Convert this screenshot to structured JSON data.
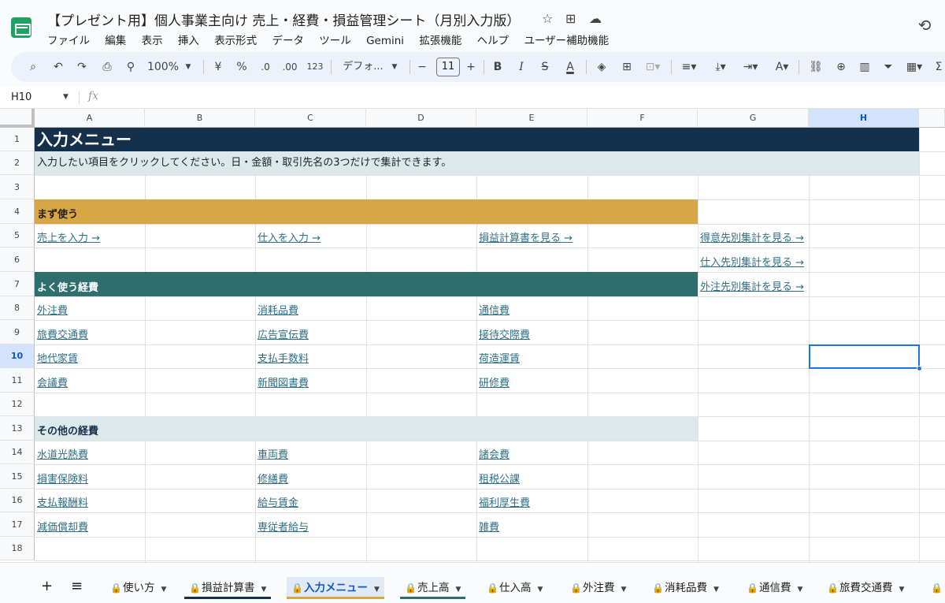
{
  "window": {
    "title": "【プレゼント用】個人事業主向け 売上・経費・損益管理シート（月別入力版）",
    "menu": [
      "ファイル",
      "編集",
      "表示",
      "挿入",
      "表示形式",
      "データ",
      "ツール",
      "Gemini",
      "拡張機能",
      "ヘルプ",
      "ユーザー補助機能"
    ]
  },
  "toolbar": {
    "zoom": "100%",
    "currency": "¥",
    "percent": "%",
    "dec_minus": ".0",
    "dec_plus": ".00",
    "number_format": "123",
    "font": "デフォ...",
    "font_size": "11"
  },
  "formula_bar": {
    "cell_ref": "H10",
    "fx": "fx"
  },
  "columns": [
    "A",
    "B",
    "C",
    "D",
    "E",
    "F",
    "G",
    "H"
  ],
  "rows": [
    "1",
    "2",
    "3",
    "4",
    "5",
    "6",
    "7",
    "8",
    "9",
    "10",
    "11",
    "12",
    "13",
    "14",
    "15",
    "16",
    "17",
    "18"
  ],
  "selected_cell": "H10",
  "sheet": {
    "title": "入力メニュー",
    "instruction": "入力したい項目をクリックしてください。日・金額・取引先名の3つだけで集計できます。",
    "section_first": "まず使う",
    "first_links": [
      "売上を入力 →",
      "仕入を入力 →",
      "損益計算書を見る →"
    ],
    "side_links": [
      "得意先別集計を見る →",
      "仕入先別集計を見る →",
      "外注先別集計を見る →"
    ],
    "section_common": "よく使う経費",
    "common": [
      [
        "外注費",
        "消耗品費",
        "通信費"
      ],
      [
        "旅費交通費",
        "広告宣伝費",
        "接待交際費"
      ],
      [
        "地代家賃",
        "支払手数料",
        "荷造運賃"
      ],
      [
        "会議費",
        "新聞図書費",
        "研修費"
      ]
    ],
    "section_other": "その他の経費",
    "other": [
      [
        "水道光熱費",
        "車両費",
        "諸会費"
      ],
      [
        "損害保険料",
        "修繕費",
        "租税公課"
      ],
      [
        "支払報酬料",
        "給与賃金",
        "福利厚生費"
      ],
      [
        "減価償却費",
        "専従者給与",
        "雑費"
      ]
    ]
  },
  "tabs": [
    "使い方",
    "損益計算書",
    "入力メニュー",
    "売上高",
    "仕入高",
    "外注費",
    "消耗品費",
    "通信費",
    "旅費交通費"
  ],
  "active_tab": "入力メニュー",
  "colors": {
    "title_bg": "#14304b",
    "instruction_bg": "#dce8ea",
    "section_first_bg": "#d7a745",
    "section_common_bg": "#2e6e6e",
    "section_other_bg": "#dce8ea",
    "link": "#2e6f86",
    "selection": "#1a73e8"
  },
  "icons": [
    "star-icon",
    "move-folder-icon",
    "cloud-status-icon",
    "history-icon",
    "search-icon",
    "undo-icon",
    "redo-icon",
    "print-icon",
    "paint-format-icon",
    "bold-icon",
    "italic-icon",
    "strikethrough-icon",
    "text-color-icon",
    "fill-color-icon",
    "borders-icon",
    "merge-icon",
    "align-icon",
    "valign-icon",
    "wrap-icon",
    "rotate-icon",
    "link-icon",
    "comment-icon",
    "chart-icon",
    "filter-icon",
    "table-view-icon",
    "add-sheet-icon",
    "all-sheets-icon",
    "lock-icon"
  ]
}
